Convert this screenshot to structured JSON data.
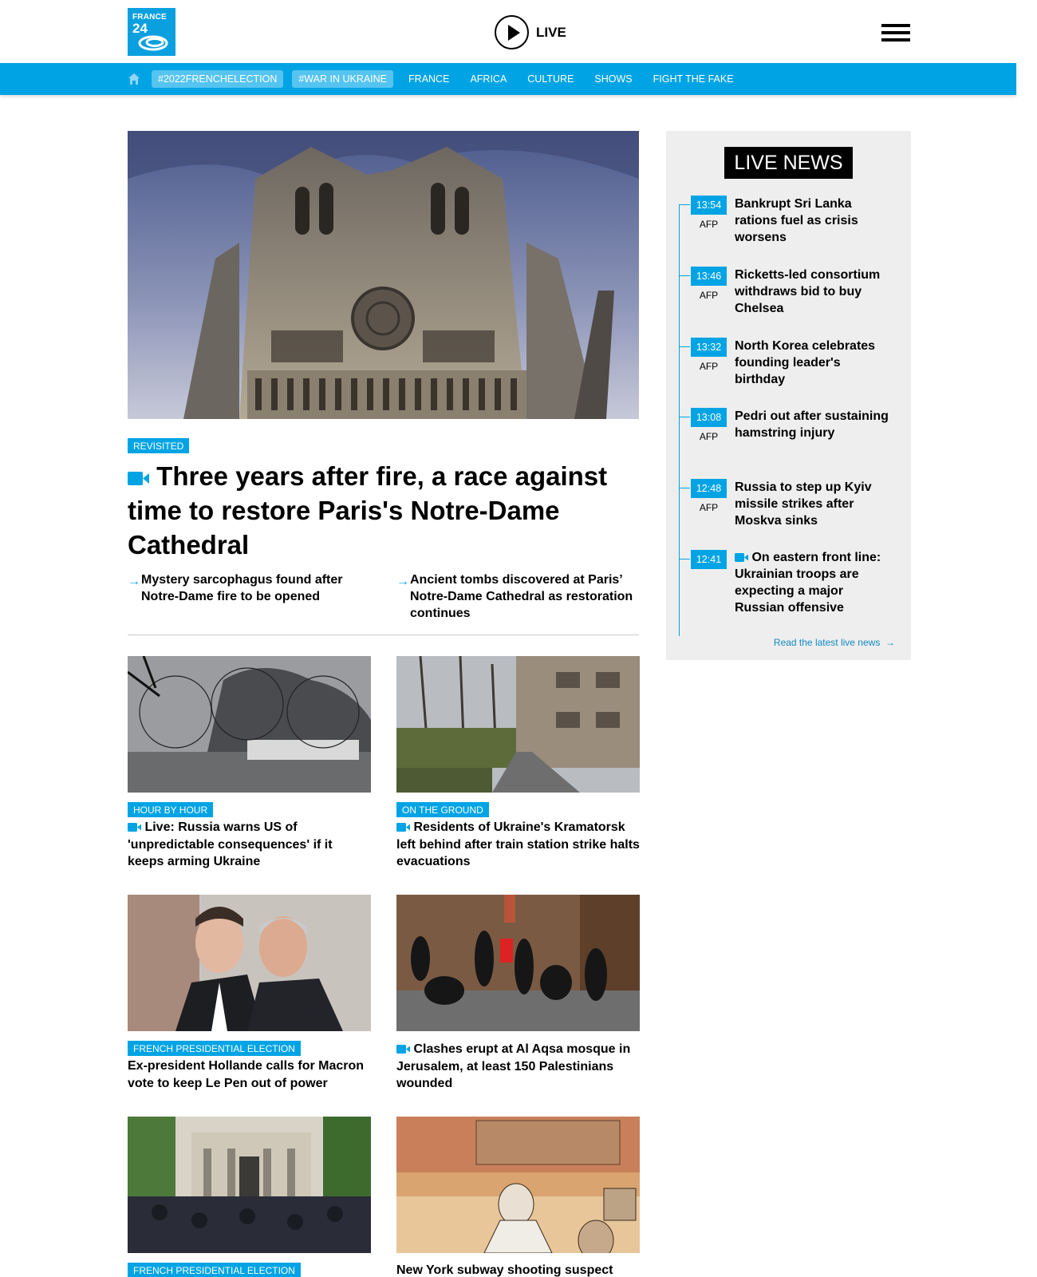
{
  "brand": {
    "logo_line1": "FRANCE",
    "logo_line2": "24"
  },
  "header": {
    "live_label": "LIVE"
  },
  "nav": {
    "pills": [
      "#2022FRENCHELECTION",
      "#WAR IN UKRAINE"
    ],
    "links": [
      "FRANCE",
      "AFRICA",
      "CULTURE",
      "SHOWS",
      "FIGHT THE FAKE"
    ]
  },
  "hero": {
    "tag": "REVISITED",
    "title": "Three years after fire, a race against time to restore Paris's Notre-Dame Cathedral",
    "related": [
      "Mystery sarcophagus found after Notre-Dame fire to be opened",
      "Ancient tombs discovered at Paris’ Notre-Dame Cathedral as restoration continues"
    ]
  },
  "cards": [
    {
      "tag": "HOUR BY HOUR",
      "title": "Live: Russia warns US of 'unpredictable consequences' if it keeps arming Ukraine",
      "video": true
    },
    {
      "tag": "ON THE GROUND",
      "title": "Residents of Ukraine's Kramatorsk left behind after train station strike halts evacuations",
      "video": true
    },
    {
      "tag": "FRENCH PRESIDENTIAL ELECTION",
      "title": "Ex-president Hollande calls for Macron vote to keep Le Pen out of power",
      "video": false
    },
    {
      "tag": "",
      "title": "Clashes erupt at Al Aqsa mosque in Jerusalem, at least 150 Palestinians wounded",
      "video": true
    },
    {
      "tag": "FRENCH PRESIDENTIAL ELECTION",
      "title": "",
      "video": false
    },
    {
      "tag": "",
      "title": "New York subway shooting suspect",
      "video": false
    }
  ],
  "live_news": {
    "heading": "LIVE NEWS",
    "items": [
      {
        "time": "13:54",
        "source": "AFP",
        "title": "Bankrupt Sri Lanka rations fuel as crisis worsens",
        "video": false
      },
      {
        "time": "13:46",
        "source": "AFP",
        "title": "Ricketts-led consortium withdraws bid to buy Chelsea",
        "video": false
      },
      {
        "time": "13:32",
        "source": "AFP",
        "title": "North Korea celebrates founding leader's birthday",
        "video": false
      },
      {
        "time": "13:08",
        "source": "AFP",
        "title": "Pedri out after sustaining hamstring injury",
        "video": false
      },
      {
        "time": "12:48",
        "source": "AFP",
        "title": "Russia to step up Kyiv missile strikes after Moskva sinks",
        "video": false
      },
      {
        "time": "12:41",
        "source": "",
        "title": "On eastern front line: Ukrainian troops are expecting a major Russian offensive",
        "video": true
      }
    ],
    "more": "Read the latest live news"
  },
  "colors": {
    "accent": "#00a4e4",
    "live_bg": "#eeeeee"
  }
}
